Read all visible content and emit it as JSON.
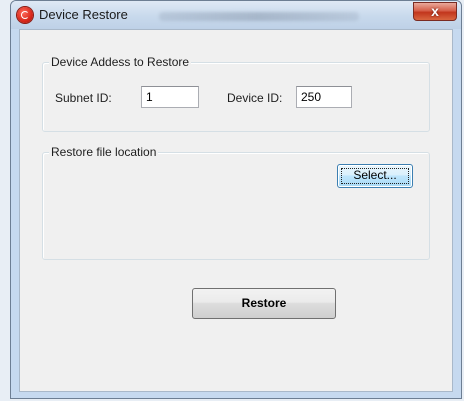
{
  "window": {
    "title": "Device Restore",
    "close_glyph": "x",
    "icon": "app-restore-icon"
  },
  "device_group": {
    "legend": "Device Addess to Restore",
    "subnet_label": "Subnet ID:",
    "subnet_value": "1",
    "device_label": "Device ID:",
    "device_value": "250"
  },
  "file_group": {
    "legend": "Restore file location",
    "select_label": "Select..."
  },
  "actions": {
    "restore_label": "Restore"
  },
  "colors": {
    "title_bar": "#c8d9ec",
    "close_button": "#c2361d",
    "client_background": "#f0f0f0",
    "focused_button": "#bee6fd"
  }
}
